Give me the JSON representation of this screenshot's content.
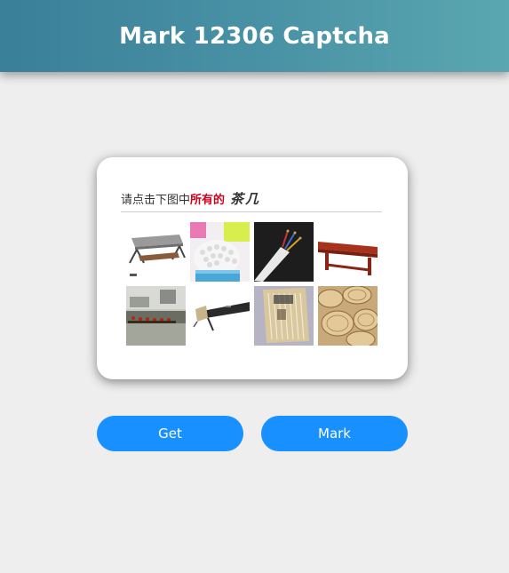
{
  "header": {
    "title": "Mark 12306 Captcha"
  },
  "captcha": {
    "prompt_prefix": "请点击下图中",
    "prompt_highlight": "所有的",
    "prompt_target": "茶几",
    "images": [
      "coffee-table",
      "cotton-swabs-bundle",
      "electrical-wires",
      "red-bench",
      "dragon-boat",
      "hair-clipper",
      "wrapped-cotton-swabs",
      "bamboo-steamers"
    ]
  },
  "buttons": {
    "get_label": "Get",
    "mark_label": "Mark"
  },
  "colors": {
    "button": "#1890ff",
    "highlight": "#d0021b",
    "header_start": "#3a7f98",
    "header_end": "#5aa7b0"
  }
}
